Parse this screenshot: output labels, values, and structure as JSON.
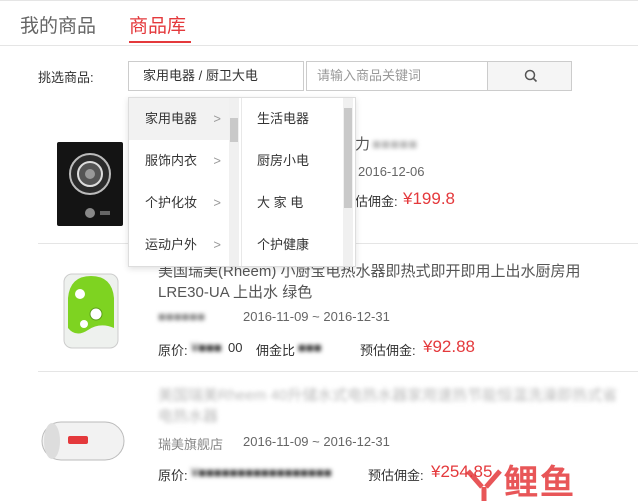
{
  "tabs": [
    {
      "label": "我的商品"
    },
    {
      "label": "商品库"
    }
  ],
  "filter": {
    "label": "挑选商品:",
    "selected_category": "家用电器 / 厨卫大电",
    "search_placeholder": "请输入商品关键词"
  },
  "dropdown": {
    "level1": [
      {
        "label": "家用电器",
        "arrow": ">"
      },
      {
        "label": "服饰内衣",
        "arrow": ">"
      },
      {
        "label": "个护化妆",
        "arrow": ">"
      },
      {
        "label": "运动户外",
        "arrow": ">"
      }
    ],
    "level2": [
      "生活电器",
      "厨房小电",
      "大 家 电",
      "个护健康"
    ]
  },
  "products": [
    {
      "title_visible": "力",
      "date": "2016-12-06",
      "commission_label": "估佣金:",
      "commission_value": "¥199.8"
    },
    {
      "title": "美国瑞美(Rheem) 小厨宝电热水器即热式即开即用上出水厨房用LRE30-UA 上出水 绿色",
      "date": "2016-11-09 ~ 2016-12-31",
      "original_price_label": "原价:",
      "original_price_tail": "00",
      "commission_rate_label": "佣金比",
      "commission_label": "预估佣金:",
      "commission_value": "¥92.88"
    },
    {
      "title": "美国瑞美Rheem 40升储水式电热水器家用速热节能恒温洗澡即热式省电热水器",
      "shop": "瑞美旗舰店",
      "date": "2016-11-09 ~ 2016-12-31",
      "original_price_label": "原价:",
      "commission_label": "预估佣金:",
      "commission_value": "¥254.85"
    }
  ],
  "watermark": "鲤鱼"
}
